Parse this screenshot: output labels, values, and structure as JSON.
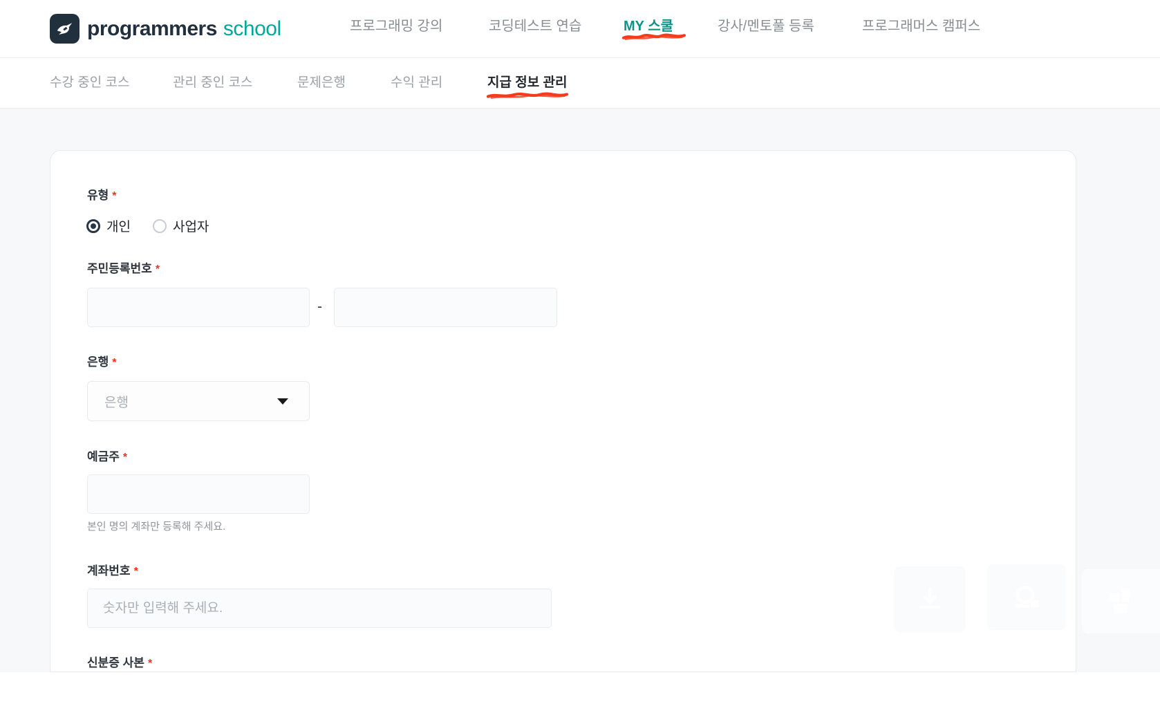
{
  "header": {
    "logo": {
      "brand": "programmers",
      "suffix": "school"
    },
    "nav": [
      {
        "label": "프로그래밍 강의"
      },
      {
        "label": "코딩테스트 연습"
      },
      {
        "label": "MY 스쿨"
      },
      {
        "label": "강사/멘토풀 등록"
      },
      {
        "label": "프로그래머스 캠퍼스"
      }
    ]
  },
  "subnav": {
    "items": [
      {
        "label": "수강 중인 코스"
      },
      {
        "label": "관리 중인 코스"
      },
      {
        "label": "문제은행"
      },
      {
        "label": "수익 관리"
      },
      {
        "label": "지급 정보 관리"
      }
    ]
  },
  "form": {
    "required_marker": "*",
    "type": {
      "label": "유형",
      "options": [
        {
          "label": "개인",
          "selected": true
        },
        {
          "label": "사업자",
          "selected": false
        }
      ]
    },
    "resident_number": {
      "label": "주민등록번호",
      "separator": "-",
      "value1": "",
      "value2": ""
    },
    "bank": {
      "label": "은행",
      "placeholder": "은행"
    },
    "account_holder": {
      "label": "예금주",
      "value": "",
      "helper": "본인 명의 계좌만 등록해 주세요."
    },
    "account_number": {
      "label": "계좌번호",
      "placeholder": "숫자만 입력해 주세요.",
      "value": ""
    },
    "id_copy": {
      "label": "신분증 사본"
    }
  },
  "colors": {
    "brand_navy": "#22303e",
    "brand_teal": "#00a79b",
    "active_teal": "#0d9488",
    "scribble_red": "#f53b1d",
    "asterisk_red": "#ff2b1e",
    "page_bg": "#f7f8fa",
    "input_bg": "#fafbfc"
  }
}
